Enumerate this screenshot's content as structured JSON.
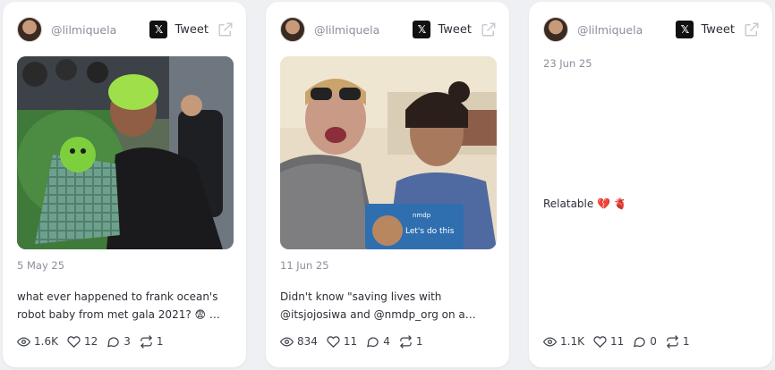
{
  "icons": {
    "x_logo": "x-logo-icon",
    "external_link": "external-link-icon",
    "views": "eye-icon",
    "likes": "heart-icon",
    "replies": "comment-icon",
    "retweets": "retweet-icon"
  },
  "colors": {
    "page_bg": "#eef0f3",
    "card_bg": "#ffffff",
    "muted_text": "#8a8f9c"
  },
  "cards": [
    {
      "handle": "@lilmiquela",
      "tweet_label": "Tweet",
      "date": "5 May 25",
      "text_line1": "what ever happened to frank ocean's",
      "text_line2": "robot baby from met gala 2021? 😨 …",
      "views": "1.6K",
      "likes": "12",
      "replies": "3",
      "retweets": "1"
    },
    {
      "handle": "@lilmiquela",
      "tweet_label": "Tweet",
      "date": "11 Jun 25",
      "text_line1": "Didn't know \"saving lives with",
      "text_line2": "@itsjojosiwa and @nmdp_org on a…",
      "photo_sign_brand": "nmdp",
      "photo_sign_text": "Let's do this",
      "views": "834",
      "likes": "11",
      "replies": "4",
      "retweets": "1"
    },
    {
      "handle": "@lilmiquela",
      "tweet_label": "Tweet",
      "date": "23 Jun 25",
      "text_line1": "Relatable 💔 🫀",
      "views": "1.1K",
      "likes": "11",
      "replies": "0",
      "retweets": "1"
    }
  ]
}
